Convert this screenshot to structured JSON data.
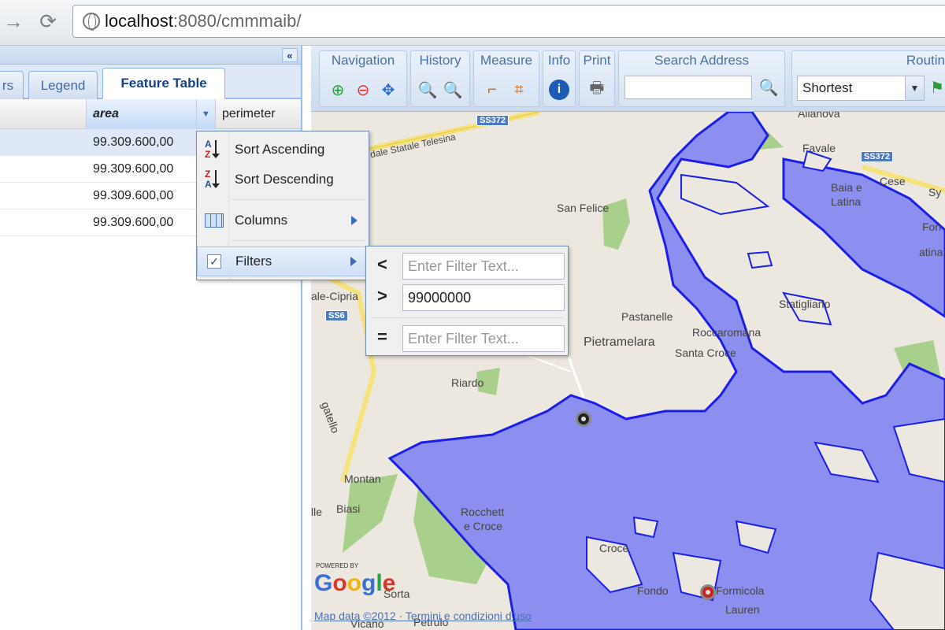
{
  "browser": {
    "url_host": "localhost",
    "url_rest": ":8080/cmmmaib/"
  },
  "left_panel": {
    "collapse_label": "«",
    "tabs": [
      {
        "label": "rs"
      },
      {
        "label": "Legend"
      },
      {
        "label": "Feature Table",
        "active": true
      }
    ],
    "grid": {
      "columns": [
        "area",
        "perimeter"
      ],
      "rows": [
        {
          "area": "99.309.600,00",
          "selected": true
        },
        {
          "area": "99.309.600,00"
        },
        {
          "area": "99.309.600,00"
        },
        {
          "area": "99.309.600,00"
        }
      ]
    },
    "column_menu": {
      "items": [
        "Sort Ascending",
        "Sort Descending",
        "Columns",
        "Filters"
      ]
    },
    "filter_menu": {
      "lt_op": "<",
      "gt_op": ">",
      "eq_op": "=",
      "lt_placeholder": "Enter Filter Text...",
      "gt_value": "99000000",
      "eq_placeholder": "Enter Filter Text..."
    }
  },
  "toolbar": {
    "groups": [
      "Navigation",
      "History",
      "Measure",
      "Info",
      "Print",
      "Search Address",
      "Routin"
    ],
    "routing_option": "Shortest"
  },
  "map": {
    "labels": [
      "Ailanova",
      "Favale",
      "Baia e",
      "Latina",
      "Cese",
      "San Felice",
      "Fon",
      "atina",
      "Statigliano",
      "ale-Cipria",
      "Pastanelle",
      "Roccaromana",
      "Pietramelara",
      "Santa Croce",
      "Riardo",
      "Montan",
      "Biasi",
      "lle",
      "Rocchett",
      "e Croce",
      "Croce",
      "Fondo",
      "Formicola",
      "Lauren",
      "Sorta",
      "Vicano",
      "Petrulo",
      "gatello",
      "dale Statale Telesina",
      "Sy"
    ],
    "shields": [
      "SS372",
      "SS372",
      "SS6"
    ],
    "attribution": "Map data ©2012 · Termini e condizioni d'uso",
    "powered_by": "POWERED BY",
    "colors": {
      "water": "#8c8ff0",
      "outline": "#1a1ee8",
      "park": "#a8cf8c"
    }
  }
}
